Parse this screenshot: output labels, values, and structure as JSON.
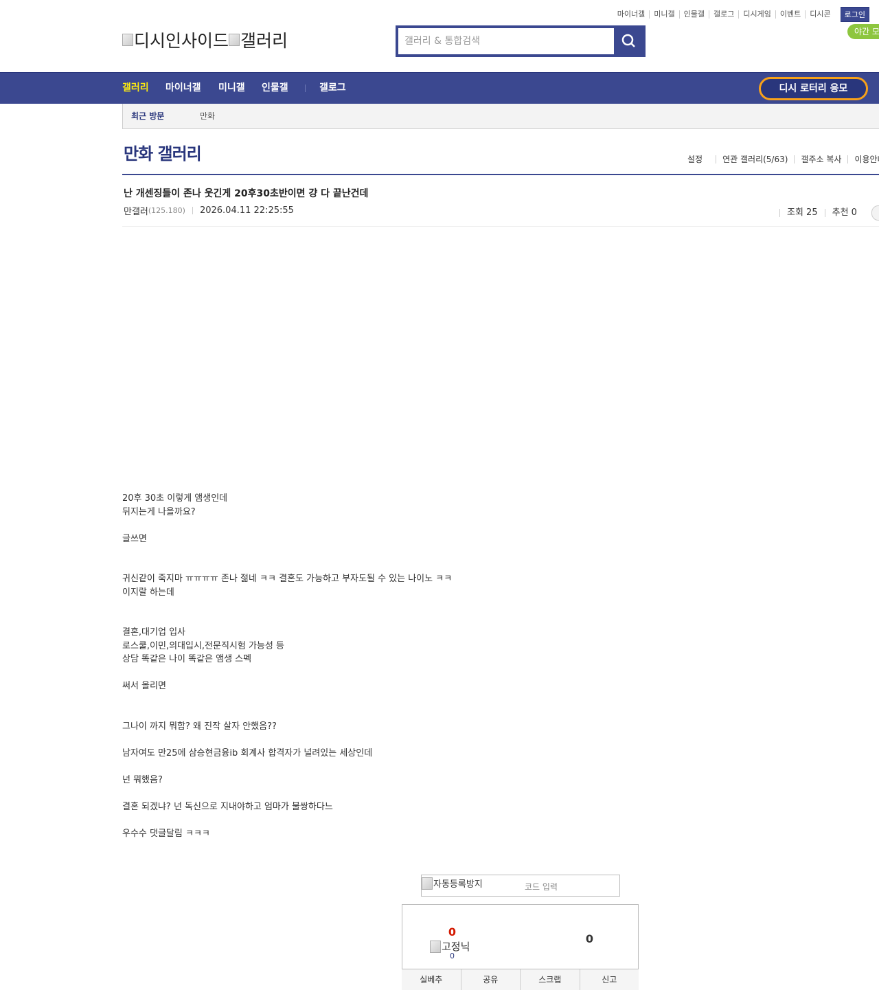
{
  "top_links": [
    "마이너갤",
    "미니갤",
    "인물갤",
    "갤로그",
    "디시게임",
    "이벤트",
    "디시콘"
  ],
  "login_label": "로그인",
  "night_mode_label": "야간 모드",
  "logo": {
    "site_alt": "디시인사이드",
    "gallery_alt": "갤러리"
  },
  "search": {
    "placeholder": "갤러리 & 통합검색"
  },
  "gnb": {
    "items": [
      "갤러리",
      "마이너갤",
      "미니갤",
      "인물갤",
      "갤로그"
    ],
    "lotto": "디시 로터리 응모"
  },
  "recent": {
    "label": "최근 방문",
    "items": [
      "만화"
    ]
  },
  "gallery": {
    "title": "만화 갤러리",
    "menu": [
      "설정",
      "연관 갤러리(5/63)",
      "갤주소 복사",
      "이용안내"
    ]
  },
  "post": {
    "title": "난 개센징들이 존나 웃긴게 20후30초반이면 걍 다 끝난건데",
    "author": "만갤러",
    "ip": "(125.180)",
    "date": "2026.04.11 22:25:55",
    "views": "조회 25",
    "recommend": "추천 0",
    "body": [
      "20후 30초 이렇게 앰생인데",
      "뒤지는게 나을까요?",
      "",
      "글쓰면",
      "",
      "",
      "귀신같이 죽지마 ㅠㅠㅠㅠ 존나 젊네 ㅋㅋ 결혼도 가능하고 부자도될 수 있는 나이노 ㅋㅋ",
      "이지랄 하는데",
      "",
      "",
      "결혼,대기업 입사",
      "로스쿨,이민,의대입시,전문직시험 가능성 등",
      "상담 똑같은 나이 똑같은 앰생 스펙",
      "",
      "써서 올리면",
      "",
      "",
      "그나이 까지 뭐함? 왜 진작 살자 안했음??",
      "",
      "남자여도 만25에 삼승현금융ib 회계사 합격자가 널려있는 세상인데",
      "",
      "넌 뭐했음?",
      "",
      "결혼 되겠냐? 넌 독신으로 지내야하고 엄마가 불쌍하다느",
      "",
      "우수수 댓글달림 ㅋㅋㅋ"
    ]
  },
  "captcha": {
    "img_alt": "자동등록방지",
    "code_placeholder": "코드 입력"
  },
  "recommend_box": {
    "up": "0",
    "fixnick_alt": "고정닉",
    "fixnick_count": "0",
    "down": "0",
    "buttons": [
      "실베추",
      "공유",
      "스크랩",
      "신고"
    ]
  }
}
